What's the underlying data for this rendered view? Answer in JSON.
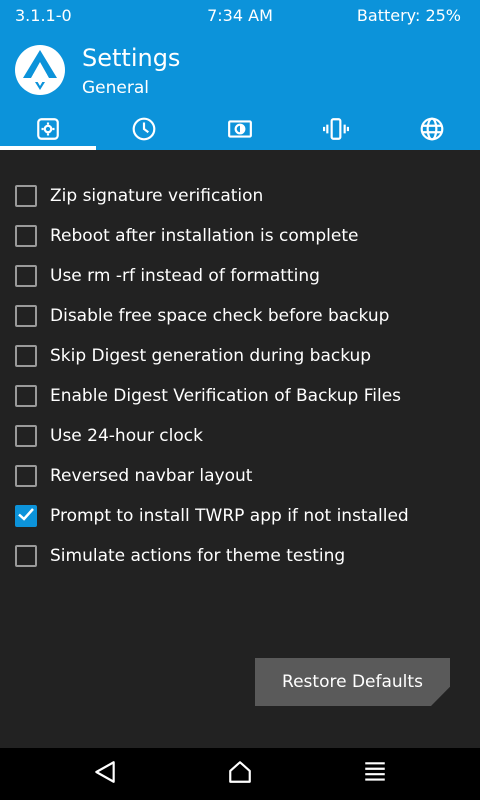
{
  "status_bar": {
    "version": "3.1.1-0",
    "time": "7:34 AM",
    "battery": "Battery: 25%"
  },
  "header": {
    "title": "Settings",
    "subtitle": "General",
    "logo_icon": "twrp-logo-icon"
  },
  "tabs": [
    {
      "icon": "gear-icon",
      "active": true
    },
    {
      "icon": "clock-icon",
      "active": false
    },
    {
      "icon": "brightness-icon",
      "active": false
    },
    {
      "icon": "vibration-icon",
      "active": false
    },
    {
      "icon": "globe-icon",
      "active": false
    }
  ],
  "options": [
    {
      "label": "Zip signature verification",
      "checked": false
    },
    {
      "label": "Reboot after installation is complete",
      "checked": false
    },
    {
      "label": "Use rm -rf instead of formatting",
      "checked": false
    },
    {
      "label": "Disable free space check before backup",
      "checked": false
    },
    {
      "label": "Skip Digest generation during backup",
      "checked": false
    },
    {
      "label": "Enable Digest Verification of Backup Files",
      "checked": false
    },
    {
      "label": "Use 24-hour clock",
      "checked": false
    },
    {
      "label": "Reversed navbar layout",
      "checked": false
    },
    {
      "label": "Prompt to install TWRP app if not installed",
      "checked": true
    },
    {
      "label": "Simulate actions for theme testing",
      "checked": false
    }
  ],
  "restore_button": {
    "label": "Restore Defaults"
  },
  "navbar": {
    "back_icon": "back-triangle-icon",
    "home_icon": "home-icon",
    "menu_icon": "menu-lines-icon"
  },
  "colors": {
    "accent": "#0c93da",
    "background": "#222222",
    "button": "#5a5a5a",
    "navbar": "#000000"
  }
}
